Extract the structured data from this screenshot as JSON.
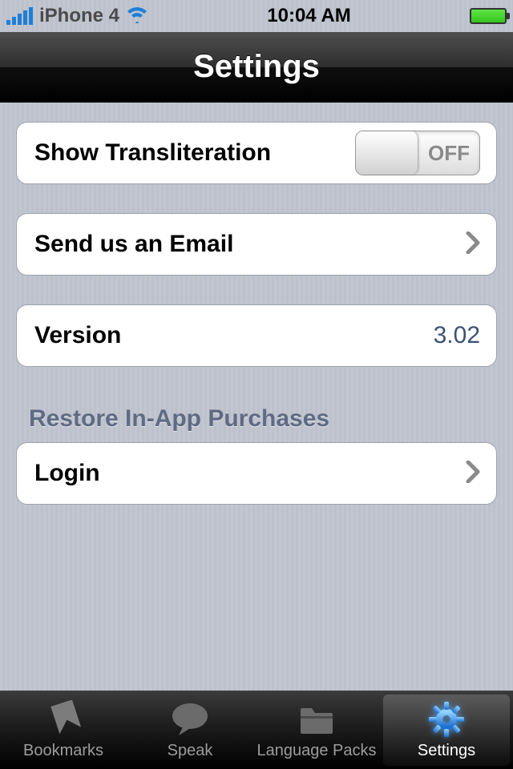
{
  "status": {
    "carrier": "iPhone 4",
    "time": "10:04 AM"
  },
  "header": {
    "title": "Settings"
  },
  "rows": {
    "transliteration": {
      "label": "Show Transliteration",
      "toggle": "OFF"
    },
    "email": {
      "label": "Send us an Email"
    },
    "version": {
      "label": "Version",
      "value": "3.02"
    },
    "restore_header": "Restore In-App Purchases",
    "login": {
      "label": "Login"
    }
  },
  "tabs": {
    "bookmarks": "Bookmarks",
    "speak": "Speak",
    "language_packs": "Language Packs",
    "settings": "Settings"
  }
}
